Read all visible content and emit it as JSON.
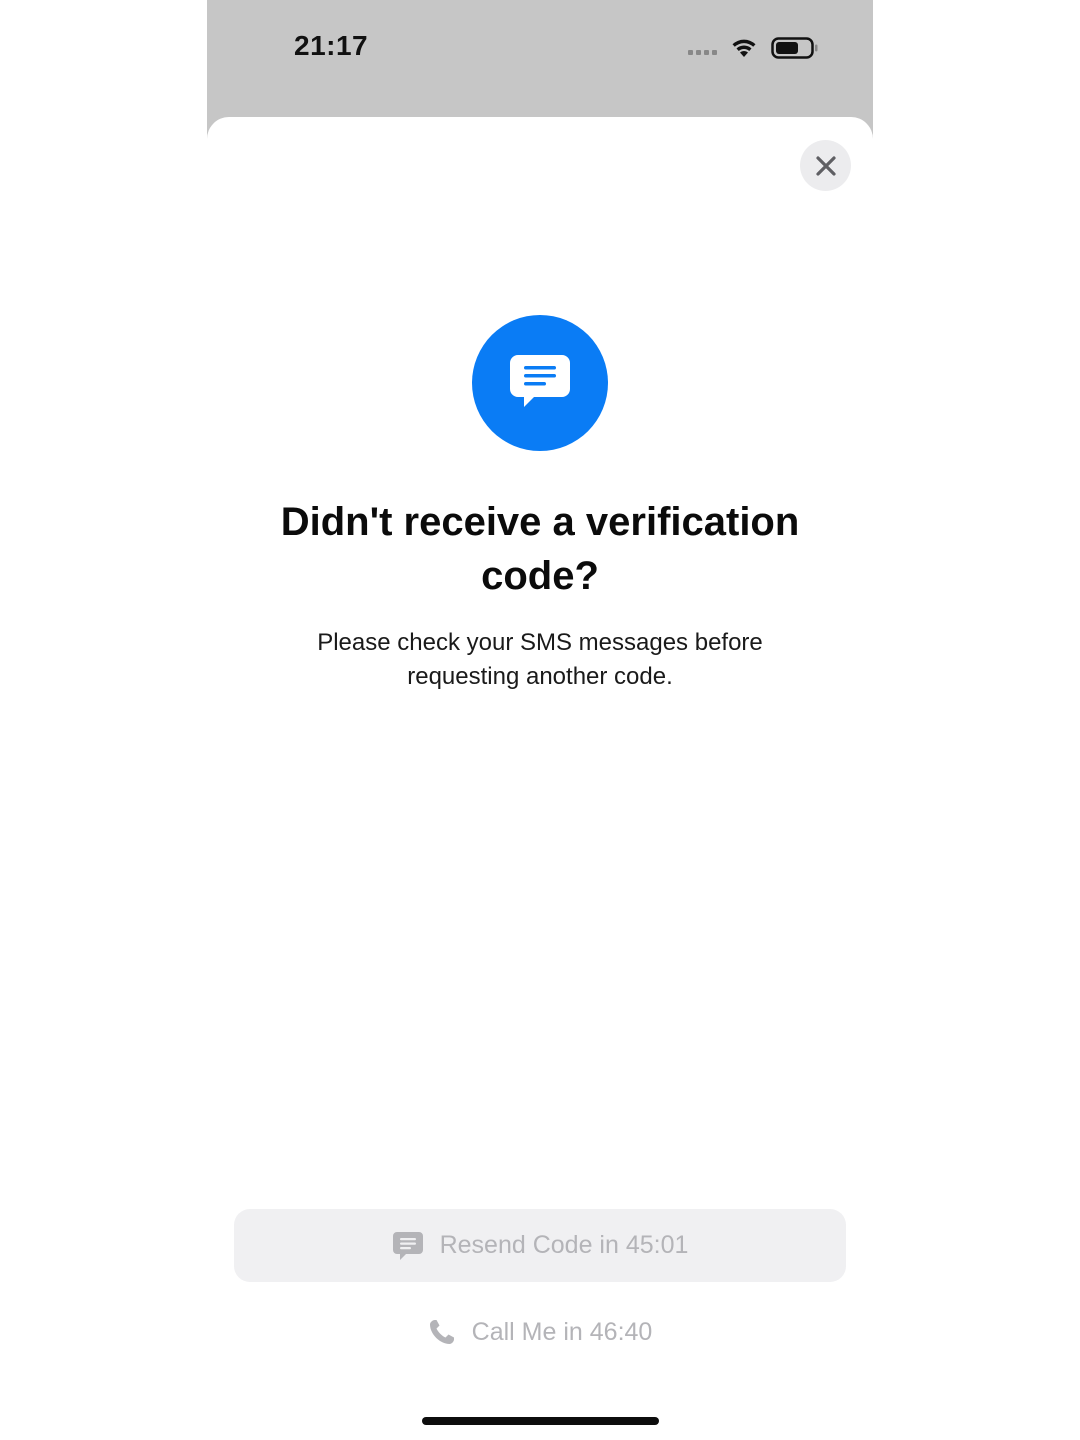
{
  "status_bar": {
    "time": "21:17"
  },
  "sheet": {
    "title": "Didn't receive a verification code?",
    "subtitle": "Please check your SMS messages before requesting another code."
  },
  "actions": {
    "resend_label": "Resend Code in 45:01",
    "call_label": "Call Me in 46:40"
  },
  "icons": {
    "close": "close-icon",
    "hero": "message-bubble-icon",
    "resend": "message-icon",
    "call": "phone-icon",
    "wifi": "wifi-icon",
    "battery": "battery-icon",
    "signal": "signal-icon"
  },
  "colors": {
    "accent": "#0a7cf5",
    "disabled_text": "#b4b4b8",
    "disabled_button_bg": "#f0f0f2"
  }
}
